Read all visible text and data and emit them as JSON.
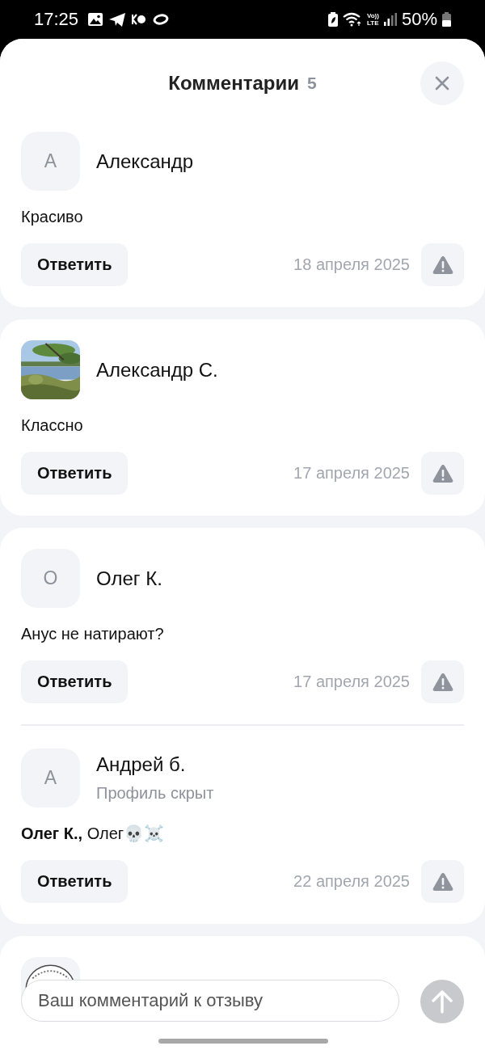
{
  "status_bar": {
    "time": "17:25",
    "volte": "Vo))",
    "lte": "LTE",
    "battery": "50%"
  },
  "header": {
    "title": "Комментарии",
    "count": "5"
  },
  "comments": [
    {
      "avatar": {
        "kind": "letter",
        "letter": "А"
      },
      "name": "Александр",
      "text": "Красиво",
      "reply_label": "Ответить",
      "date": "18 апреля 2025"
    },
    {
      "name": "Александр С.",
      "text": "Классно",
      "reply_label": "Ответить",
      "date": "17 апреля 2025"
    },
    {
      "avatar": {
        "kind": "letter",
        "letter": "О"
      },
      "name": "Олег К.",
      "text": "Анус не натирают?",
      "reply_label": "Ответить",
      "date": "17 апреля 2025",
      "children": [
        {
          "avatar": {
            "kind": "letter",
            "letter": "А"
          },
          "name": "Андрей б.",
          "subtitle": "Профиль скрыт",
          "text": "**Олег К.,** Олег💀☠️",
          "reply_label": "Ответить",
          "date": "22 апреля 2025"
        }
      ]
    },
    {
      "avatar": {
        "kind": "logo"
      }
    }
  ],
  "composer": {
    "placeholder": "Ваш комментарий к отзыву"
  }
}
